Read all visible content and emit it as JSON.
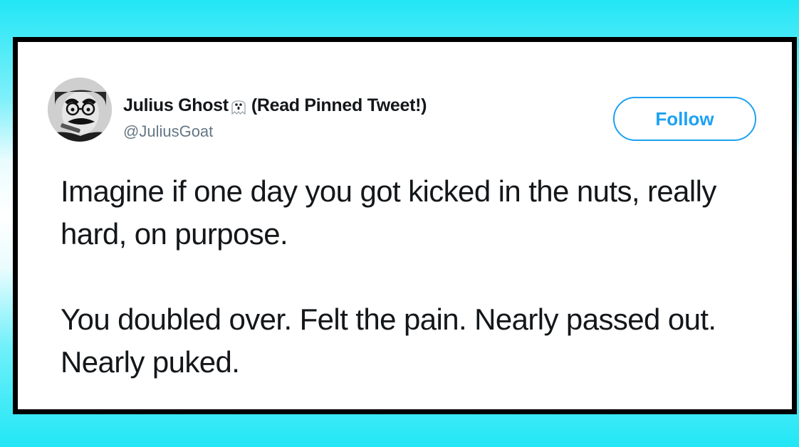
{
  "tweet": {
    "author": {
      "display_name": "Julius Ghost",
      "name_suffix": "(Read Pinned Tweet!)",
      "emoji_icon": "ghost-emoji-icon",
      "handle": "@JuliusGoat"
    },
    "follow_label": "Follow",
    "paragraphs": [
      "Imagine if one day you got kicked in the nuts, really hard, on purpose.",
      "You doubled over. Felt the pain. Nearly passed out. Nearly puked."
    ]
  },
  "colors": {
    "background": "#22e6f5",
    "card_border": "#000000",
    "follow_blue": "#1da1f2",
    "text": "#14171a",
    "muted": "#657786"
  }
}
